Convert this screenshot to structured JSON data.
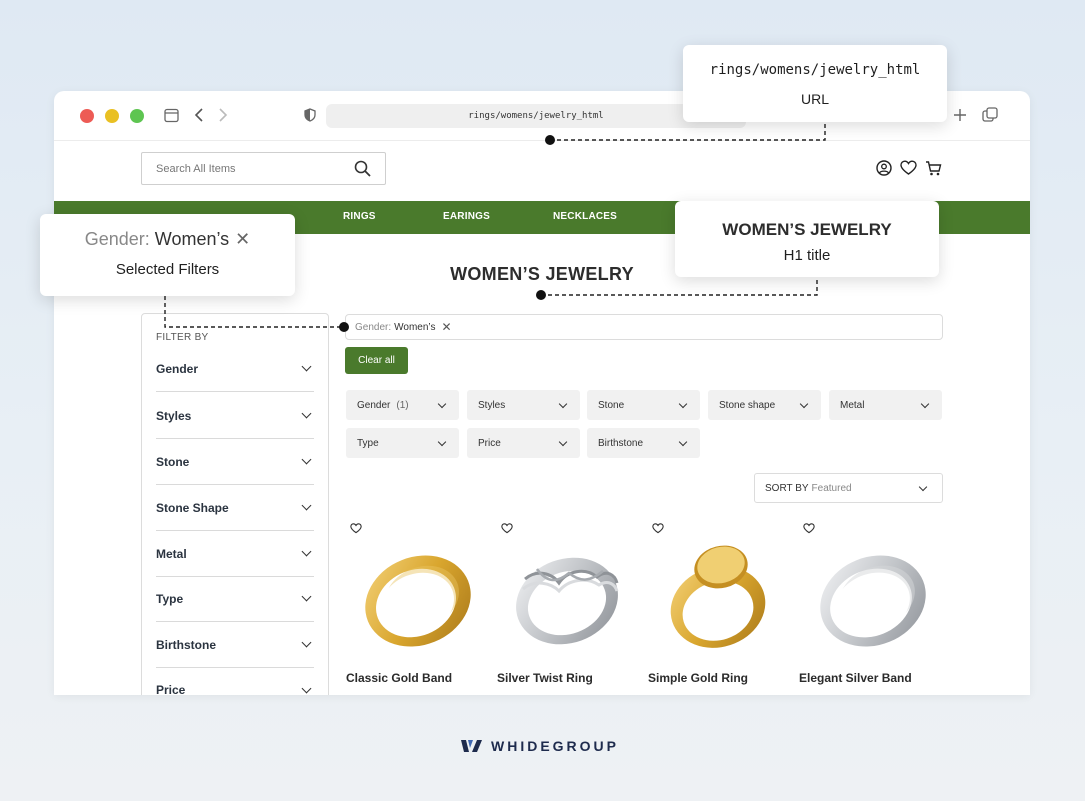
{
  "browser": {
    "url": "rings/womens/jewelry_html"
  },
  "header": {
    "search_placeholder": "Search All Items",
    "icons": [
      "user-icon",
      "heart-icon",
      "cart-icon"
    ]
  },
  "nav": {
    "items": [
      "RINGS",
      "EARINGS",
      "NECKLACES"
    ]
  },
  "page": {
    "title": "WOMEN’S JEWELRY"
  },
  "sidebar": {
    "heading": "FILTER BY",
    "filters": [
      "Gender",
      "Styles",
      "Stone",
      "Stone Shape",
      "Metal",
      "Type",
      "Birthstone",
      "Price"
    ]
  },
  "selected_filters": {
    "key": "Gender:",
    "value": "Women’s",
    "clear_label": "Clear all"
  },
  "filter_buttons": [
    {
      "label": "Gender",
      "count": "(1)"
    },
    {
      "label": "Styles",
      "count": ""
    },
    {
      "label": "Stone",
      "count": ""
    },
    {
      "label": "Stone shape",
      "count": ""
    },
    {
      "label": "Metal",
      "count": ""
    },
    {
      "label": "Type",
      "count": ""
    },
    {
      "label": "Price",
      "count": ""
    },
    {
      "label": "Birthstone",
      "count": ""
    }
  ],
  "sort": {
    "label": "SORT BY",
    "value": "Featured"
  },
  "products": [
    {
      "name": "Classic Gold Band",
      "metal": "gold"
    },
    {
      "name": "Silver Twist Ring",
      "metal": "silver"
    },
    {
      "name": "Simple Gold Ring",
      "metal": "gold"
    },
    {
      "name": "Elegant Silver Band",
      "metal": "silver"
    }
  ],
  "callouts": {
    "url": {
      "text": "rings/womens/jewelry_html",
      "caption": "URL"
    },
    "filter": {
      "key": "Gender:",
      "value": "Women’s",
      "caption": "Selected Filters"
    },
    "h1": {
      "text": "WOMEN’S JEWELRY",
      "caption": "H1 title"
    }
  },
  "brand": {
    "logo_text": "WHIDEGROUP"
  },
  "colors": {
    "nav_green": "#4a7a2c",
    "gold": "#d9a62e",
    "silver": "#bfc2c6"
  }
}
